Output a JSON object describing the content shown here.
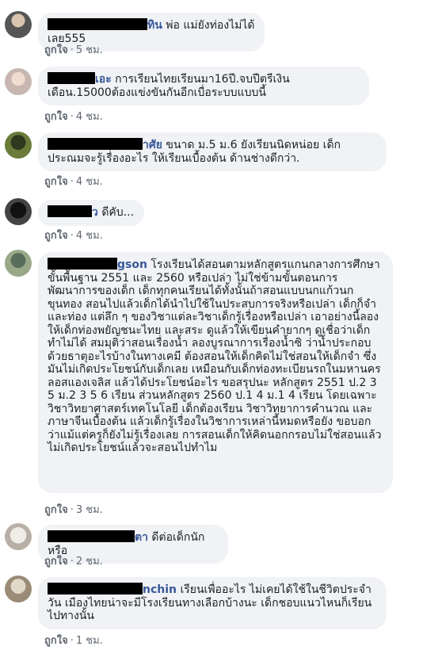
{
  "like_label": "ถูกใจ",
  "comments": [
    {
      "name_suffix": "ทิน",
      "text": "พ่อ แม่ยังท่องไม่ได้เลย555",
      "time": "5 ชม."
    },
    {
      "name_suffix": "เอะ",
      "text": "การเรียนไทยเรียนมา16ปี.จบปีตรีเงินเดือน.15000ต้องแข่งขันกันอีกเบื่อระบบแบบนี้",
      "time": "4 ชม."
    },
    {
      "name_suffix": "าศัย",
      "text": "ขนาด ม.5 ม.6 ยังเรียนนิดหน่อย เด็ก ประณมจะรู้เรื่องอะไร ให้เรียนเบื้องต้น ด้านช่างดีกว่า.",
      "time": "4 ชม."
    },
    {
      "name_suffix": "ว",
      "text": "ดีคับ...",
      "time": "4 ชม."
    },
    {
      "name_suffix": "gson",
      "text": "โรงเรียนได้สอนตามหลักสูตรแกนกลางการศึกษาขั้นพื้นฐาน 2551 และ 2560 หรือเปล่า ไม่ใช่ข้ามขั้นตอนการพัฒนาการของเด็ก เด็กทุกคนเรียนได้ทั้งนั้นถ้าสอนแบบนกแก้วนกขุนทอง สอนไปแล้วเด็กได้นำไปใช้ในประสบการจริงหรือเปล่า เด็กก็จำและท่อง แต่ลึก ๆ ของวิชาแต่ละวิชาเด็กรู้เรื่องหรือเปล่า เอาอย่างนี้ลองให้เด็กท่องพยัญชนะไทย และสระ ดูแล้วให้เขียนคำยากๆ ดูเชื่อว่าเด็กทำไม่ได้ สมมุติว่าสอนเรื่องน้ำ ลองบูรณาการเรื่องน้ำซิ ว่าน้ำประกอบด้วยธาตุอะไรบ้างในทางเคมี ต้องสอนให้เด็กคิดไม่ใช่สอนให้เด็กจำ ซึ่งมันไม่เกิดประโยชน์กับเด็กเลย เหมือนกับเด็กท่องทะเบียนรถในมหานครลอสแองเจลิส แล้วได้ประโยชน์อะไร ขอสรุปนะ หลักสูตร 2551 ป.2 3 5 ม.2 3 5 6 เรียน ส่วนหลักสูตร 2560 ป.1 4 ม.1 4 เรียน โดยเฉพาะวิชาวิทยาศาสตร์เทคโนโลยี เด็กต้องเรียน วิชาวิทยาการคำนวณ และภาษาจีนเบื้องต้น แล้วเด็กรู้เรื่องในวิชาการเหล่านี้หมดหรือยัง ขอบอกว่าแม้แต่ครูก็ยังไม่รู้เรื่องเลย การสอนเด็กให้คิดนอกกรอบไม่ใช่สอนแล้วไม่เกิดประโยชน์แล้วจะสอนไปทำไม",
      "time": "3 ชม."
    },
    {
      "name_suffix": "ตา",
      "text": "ดีต่อเด็กนักหรือ",
      "time": "2 ชม."
    },
    {
      "name_suffix": "nchin",
      "text": "เรียนเพื่ออะไร ไม่เคยได้ใช้ในชีวิตประจำวัน เมืองไทยน่าจะมีโรงเรียนทางเลือกบ้างนะ เด็กชอบแนวไหนก็เรียนไปทางนั้น",
      "time": "1 ชม."
    }
  ]
}
